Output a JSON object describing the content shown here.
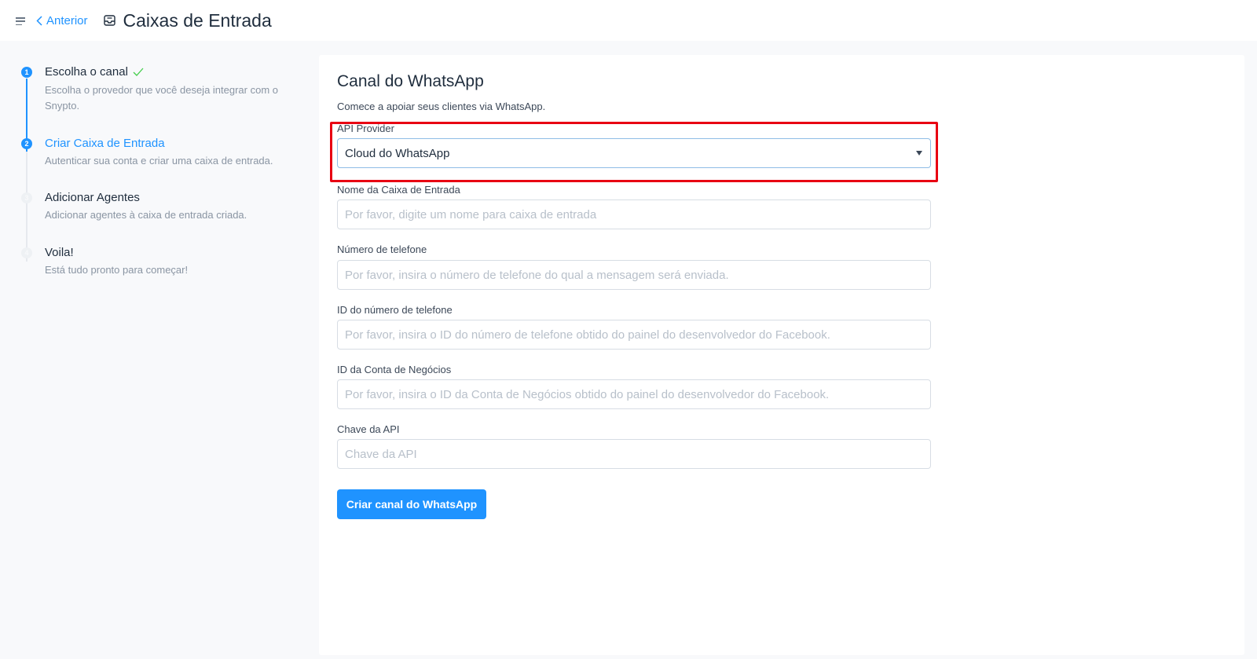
{
  "header": {
    "back_label": "Anterior",
    "title": "Caixas de Entrada"
  },
  "steps": [
    {
      "number": "1",
      "title": "Escolha o canal",
      "description": "Escolha o provedor que você deseja integrar com o Snypto.",
      "state": "completed"
    },
    {
      "number": "2",
      "title": "Criar Caixa de Entrada",
      "description": "Autenticar sua conta e criar uma caixa de entrada.",
      "state": "active"
    },
    {
      "number": "3",
      "title": "Adicionar Agentes",
      "description": "Adicionar agentes à caixa de entrada criada.",
      "state": "pending"
    },
    {
      "number": "4",
      "title": "Voila!",
      "description": "Está tudo pronto para começar!",
      "state": "pending"
    }
  ],
  "form": {
    "title": "Canal do WhatsApp",
    "subtitle": "Comece a apoiar seus clientes via WhatsApp.",
    "api_provider": {
      "label": "API Provider",
      "selected": "Cloud do WhatsApp"
    },
    "inbox_name": {
      "label": "Nome da Caixa de Entrada",
      "placeholder": "Por favor, digite um nome para caixa de entrada",
      "value": ""
    },
    "phone_number": {
      "label": "Número de telefone",
      "placeholder": "Por favor, insira o número de telefone do qual a mensagem será enviada.",
      "value": ""
    },
    "phone_number_id": {
      "label": "ID do número de telefone",
      "placeholder": "Por favor, insira o ID do número de telefone obtido do painel do desenvolvedor do Facebook.",
      "value": ""
    },
    "business_account_id": {
      "label": "ID da Conta de Negócios",
      "placeholder": "Por favor, insira o ID da Conta de Negócios obtido do painel do desenvolvedor do Facebook.",
      "value": ""
    },
    "api_key": {
      "label": "Chave da API",
      "placeholder": "Chave da API",
      "value": ""
    },
    "submit_label": "Criar canal do WhatsApp"
  },
  "colors": {
    "accent": "#1f93ff",
    "highlight": "#e80012",
    "success": "#44ce4b"
  },
  "icons": {
    "menu": "menu-icon",
    "back": "chevron-left-icon",
    "inbox": "inbox-icon",
    "check": "check-icon",
    "select": "caret-down-icon"
  }
}
